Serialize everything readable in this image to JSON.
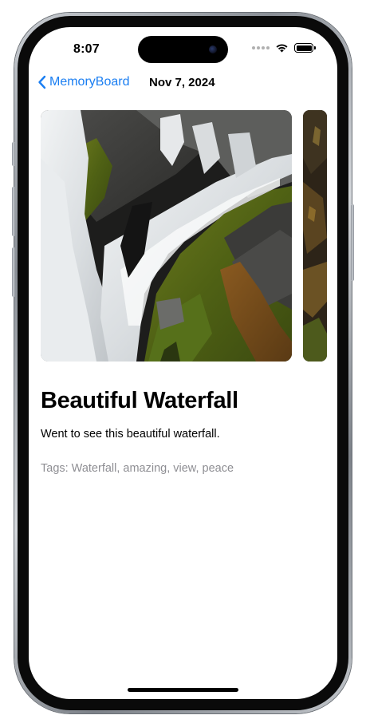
{
  "status_bar": {
    "time": "8:07"
  },
  "nav": {
    "back_label": "MemoryBoard",
    "title": "Nov 7, 2024"
  },
  "memory": {
    "title": "Beautiful Waterfall",
    "description": "Went to see this beautiful waterfall.",
    "tags_text": "Tags: Waterfall, amazing, view, peace"
  },
  "colors": {
    "accent": "#1a7ef2",
    "tags_gray": "#8e8e93"
  },
  "icons": {
    "back": "chevron-left-icon",
    "wifi": "wifi-icon",
    "battery": "battery-icon",
    "signal": "cellular-signal-icon"
  }
}
